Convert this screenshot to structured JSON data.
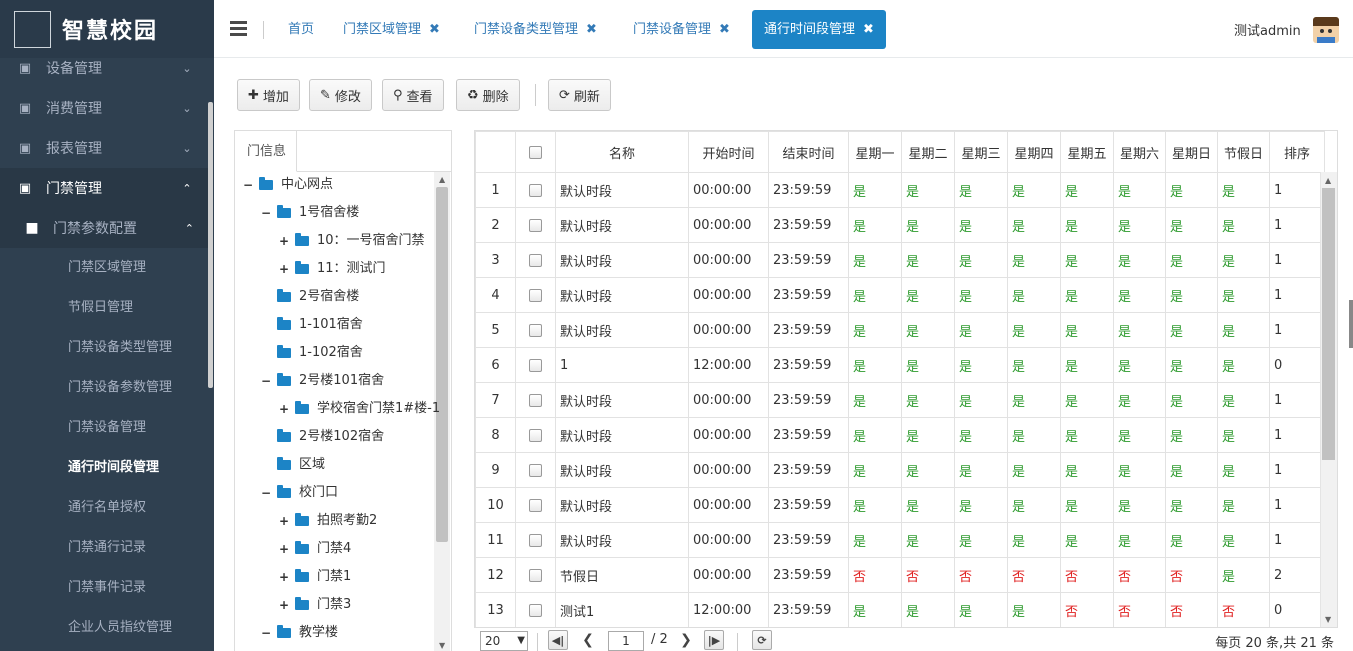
{
  "app": {
    "title": "智慧校园"
  },
  "sidebar": {
    "menus": [
      {
        "label": "设备管理",
        "icon": "briefcase-icon"
      },
      {
        "label": "消费管理",
        "icon": "briefcase-icon"
      },
      {
        "label": "报表管理",
        "icon": "briefcase-icon"
      },
      {
        "label": "门禁管理",
        "icon": "briefcase-icon"
      }
    ],
    "subgroup": "门禁参数配置",
    "subitems": [
      "门禁区域管理",
      "节假日管理",
      "门禁设备类型管理",
      "门禁设备参数管理",
      "门禁设备管理",
      "通行时间段管理",
      "通行名单授权",
      "门禁通行记录",
      "门禁事件记录",
      "企业人员指纹管理"
    ],
    "active_subitem": "通行时间段管理"
  },
  "topbar": {
    "tabs": [
      {
        "label": "首页",
        "closable": false
      },
      {
        "label": "门禁区域管理",
        "closable": true
      },
      {
        "label": "门禁设备类型管理",
        "closable": true
      },
      {
        "label": "门禁设备管理",
        "closable": true
      },
      {
        "label": "通行时间段管理",
        "closable": true,
        "active": true
      }
    ],
    "user": "测试admin"
  },
  "toolbar": {
    "add": "增加",
    "edit": "修改",
    "view": "查看",
    "delete": "删除",
    "refresh": "刷新"
  },
  "tree": {
    "tab": "门信息",
    "nodes": [
      {
        "label": "中心网点",
        "toggle": "−"
      },
      {
        "label": "1号宿舍楼",
        "toggle": "−"
      },
      {
        "label": "10：一号宿舍门禁",
        "toggle": "+"
      },
      {
        "label": "11：测试门",
        "toggle": "+"
      },
      {
        "label": "2号宿舍楼",
        "toggle": ""
      },
      {
        "label": "1-101宿舍",
        "toggle": ""
      },
      {
        "label": "1-102宿舍",
        "toggle": ""
      },
      {
        "label": "2号楼101宿舍",
        "toggle": "−"
      },
      {
        "label": "学校宿舍门禁1#楼-1",
        "toggle": "+"
      },
      {
        "label": "2号楼102宿舍",
        "toggle": ""
      },
      {
        "label": "区域",
        "toggle": ""
      },
      {
        "label": "校门口",
        "toggle": "−"
      },
      {
        "label": "拍照考勤2",
        "toggle": "+"
      },
      {
        "label": "门禁4",
        "toggle": "+"
      },
      {
        "label": "门禁1",
        "toggle": "+"
      },
      {
        "label": "门禁3",
        "toggle": "+"
      },
      {
        "label": "教学楼",
        "toggle": "−"
      }
    ]
  },
  "grid": {
    "headers": [
      "",
      "",
      "名称",
      "开始时间",
      "结束时间",
      "星期一",
      "星期二",
      "星期三",
      "星期四",
      "星期五",
      "星期六",
      "星期日",
      "节假日",
      "排序"
    ],
    "rows": [
      {
        "no": "1",
        "name": "默认时段",
        "start": "00:00:00",
        "end": "23:59:59",
        "days": [
          "是",
          "是",
          "是",
          "是",
          "是",
          "是",
          "是",
          "是"
        ],
        "sort": "1"
      },
      {
        "no": "2",
        "name": "默认时段",
        "start": "00:00:00",
        "end": "23:59:59",
        "days": [
          "是",
          "是",
          "是",
          "是",
          "是",
          "是",
          "是",
          "是"
        ],
        "sort": "1"
      },
      {
        "no": "3",
        "name": "默认时段",
        "start": "00:00:00",
        "end": "23:59:59",
        "days": [
          "是",
          "是",
          "是",
          "是",
          "是",
          "是",
          "是",
          "是"
        ],
        "sort": "1"
      },
      {
        "no": "4",
        "name": "默认时段",
        "start": "00:00:00",
        "end": "23:59:59",
        "days": [
          "是",
          "是",
          "是",
          "是",
          "是",
          "是",
          "是",
          "是"
        ],
        "sort": "1"
      },
      {
        "no": "5",
        "name": "默认时段",
        "start": "00:00:00",
        "end": "23:59:59",
        "days": [
          "是",
          "是",
          "是",
          "是",
          "是",
          "是",
          "是",
          "是"
        ],
        "sort": "1"
      },
      {
        "no": "6",
        "name": "1",
        "start": "12:00:00",
        "end": "23:59:59",
        "days": [
          "是",
          "是",
          "是",
          "是",
          "是",
          "是",
          "是",
          "是"
        ],
        "sort": "0"
      },
      {
        "no": "7",
        "name": "默认时段",
        "start": "00:00:00",
        "end": "23:59:59",
        "days": [
          "是",
          "是",
          "是",
          "是",
          "是",
          "是",
          "是",
          "是"
        ],
        "sort": "1"
      },
      {
        "no": "8",
        "name": "默认时段",
        "start": "00:00:00",
        "end": "23:59:59",
        "days": [
          "是",
          "是",
          "是",
          "是",
          "是",
          "是",
          "是",
          "是"
        ],
        "sort": "1"
      },
      {
        "no": "9",
        "name": "默认时段",
        "start": "00:00:00",
        "end": "23:59:59",
        "days": [
          "是",
          "是",
          "是",
          "是",
          "是",
          "是",
          "是",
          "是"
        ],
        "sort": "1"
      },
      {
        "no": "10",
        "name": "默认时段",
        "start": "00:00:00",
        "end": "23:59:59",
        "days": [
          "是",
          "是",
          "是",
          "是",
          "是",
          "是",
          "是",
          "是"
        ],
        "sort": "1"
      },
      {
        "no": "11",
        "name": "默认时段",
        "start": "00:00:00",
        "end": "23:59:59",
        "days": [
          "是",
          "是",
          "是",
          "是",
          "是",
          "是",
          "是",
          "是"
        ],
        "sort": "1"
      },
      {
        "no": "12",
        "name": "节假日",
        "start": "00:00:00",
        "end": "23:59:59",
        "days": [
          "否",
          "否",
          "否",
          "否",
          "否",
          "否",
          "否",
          "是"
        ],
        "sort": "2"
      },
      {
        "no": "13",
        "name": "测试1",
        "start": "12:00:00",
        "end": "23:59:59",
        "days": [
          "是",
          "是",
          "是",
          "是",
          "否",
          "否",
          "否",
          "否"
        ],
        "sort": "0"
      }
    ]
  },
  "pager": {
    "page_size": "20",
    "current_page": "1",
    "total_pages": "/ 2",
    "info": "每页 20 条,共 21 条"
  },
  "colors": {
    "sidebar_bg": "#2f4050",
    "accent": "#1c84c6",
    "yes": "#2e9b2e",
    "no": "#e02020"
  }
}
